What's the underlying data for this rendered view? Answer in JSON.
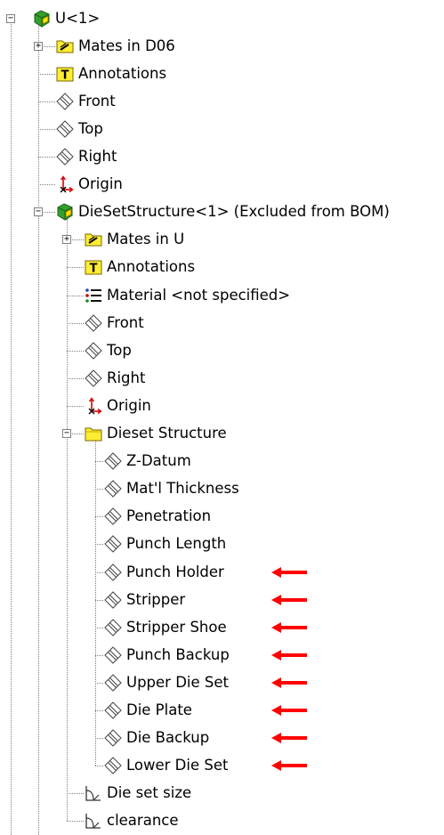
{
  "tree": {
    "items": [
      {
        "label": "U<1>",
        "icon": "part-icon",
        "depth": 0,
        "expander": "minus"
      },
      {
        "label": "Mates in D06",
        "icon": "mates-folder-icon",
        "depth": 1,
        "expander": "plus"
      },
      {
        "label": "Annotations",
        "icon": "annotations-icon",
        "depth": 1
      },
      {
        "label": "Front",
        "icon": "plane-icon",
        "depth": 1
      },
      {
        "label": "Top",
        "icon": "plane-icon",
        "depth": 1
      },
      {
        "label": "Right",
        "icon": "plane-icon",
        "depth": 1
      },
      {
        "label": "Origin",
        "icon": "origin-icon",
        "depth": 1
      },
      {
        "label": "DieSetStructure<1> (Excluded from BOM)",
        "icon": "part-icon",
        "depth": 1,
        "expander": "minus"
      },
      {
        "label": "Mates in U",
        "icon": "mates-folder-icon",
        "depth": 2,
        "expander": "plus"
      },
      {
        "label": "Annotations",
        "icon": "annotations-icon",
        "depth": 2
      },
      {
        "label": "Material <not specified>",
        "icon": "material-icon",
        "depth": 2
      },
      {
        "label": "Front",
        "icon": "plane-icon",
        "depth": 2
      },
      {
        "label": "Top",
        "icon": "plane-icon",
        "depth": 2
      },
      {
        "label": "Right",
        "icon": "plane-icon",
        "depth": 2
      },
      {
        "label": "Origin",
        "icon": "origin-icon",
        "depth": 2
      },
      {
        "label": "Dieset Structure",
        "icon": "folder-icon",
        "depth": 2,
        "expander": "minus"
      },
      {
        "label": "Z-Datum",
        "icon": "plane-icon",
        "depth": 3
      },
      {
        "label": "Mat'l Thickness",
        "icon": "plane-icon",
        "depth": 3
      },
      {
        "label": "Penetration",
        "icon": "plane-icon",
        "depth": 3
      },
      {
        "label": "Punch Length",
        "icon": "plane-icon",
        "depth": 3
      },
      {
        "label": "Punch Holder",
        "icon": "plane-icon",
        "depth": 3,
        "arrow": true
      },
      {
        "label": "Stripper",
        "icon": "plane-icon",
        "depth": 3,
        "arrow": true
      },
      {
        "label": "Stripper Shoe",
        "icon": "plane-icon",
        "depth": 3,
        "arrow": true
      },
      {
        "label": "Punch Backup",
        "icon": "plane-icon",
        "depth": 3,
        "arrow": true
      },
      {
        "label": "Upper Die Set",
        "icon": "plane-icon",
        "depth": 3,
        "arrow": true
      },
      {
        "label": "Die Plate",
        "icon": "plane-icon",
        "depth": 3,
        "arrow": true
      },
      {
        "label": "Die Backup",
        "icon": "plane-icon",
        "depth": 3,
        "arrow": true
      },
      {
        "label": "Lower Die Set",
        "icon": "plane-icon",
        "depth": 3,
        "arrow": true
      },
      {
        "label": "Die  set size",
        "icon": "sketch-icon",
        "depth": 2
      },
      {
        "label": "clearance",
        "icon": "sketch-icon",
        "depth": 2
      }
    ]
  },
  "colors": {
    "arrow": "#ff0000",
    "part_green": "#33a02c",
    "part_yellow": "#ffe600",
    "folder_yellow": "#ffee33",
    "origin_red": "#d40000",
    "material_blue": "#1f3fbf"
  }
}
